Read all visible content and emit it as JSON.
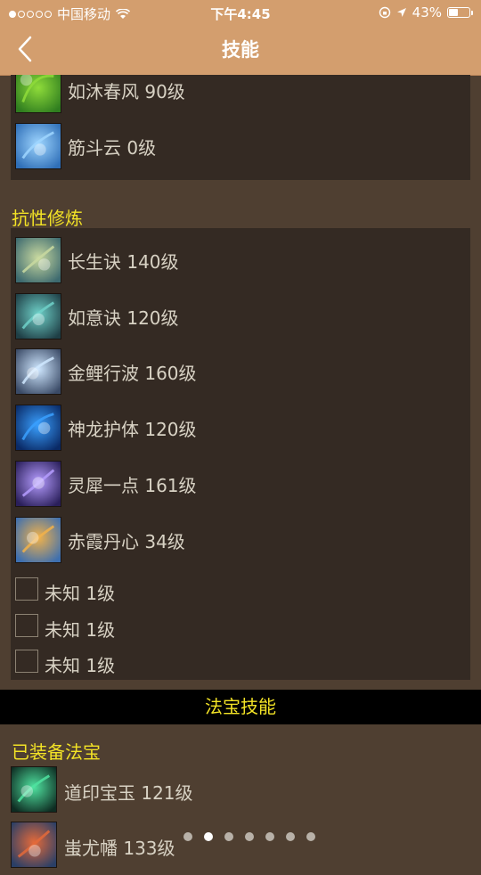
{
  "status_bar": {
    "carrier": "中国移动",
    "time": "下午4:45",
    "battery": "43%",
    "signal_bars_filled": 1
  },
  "nav": {
    "title": "技能"
  },
  "panel_top": {
    "items": [
      {
        "label": "如沐春风 90级",
        "icon": "spring-breeze-skill-icon",
        "colors": [
          "#8fdc3a",
          "#2f7d1f"
        ]
      },
      {
        "label": "筋斗云 0级",
        "icon": "somersault-cloud-skill-icon",
        "colors": [
          "#9fd6ff",
          "#2f6fb8"
        ]
      }
    ]
  },
  "resistance": {
    "title": "抗性修炼",
    "items": [
      {
        "label": "长生诀 140级",
        "icon": "longevity-skill-icon",
        "colors": [
          "#c9d9a0",
          "#3d6a6f"
        ]
      },
      {
        "label": "如意诀 120级",
        "icon": "ruyi-skill-icon",
        "colors": [
          "#6fd1c9",
          "#1f3f46"
        ]
      },
      {
        "label": "金鲤行波 160级",
        "icon": "golden-carp-skill-icon",
        "colors": [
          "#cfe7ff",
          "#3a4a66"
        ]
      },
      {
        "label": "神龙护体 120级",
        "icon": "dragon-guard-skill-icon",
        "colors": [
          "#3aa0ff",
          "#0a2a66"
        ]
      },
      {
        "label": "灵犀一点 161级",
        "icon": "lingxi-skill-icon",
        "colors": [
          "#b59cff",
          "#2a1f5a"
        ]
      },
      {
        "label": "赤霞丹心 34级",
        "icon": "crimson-cloud-skill-icon",
        "colors": [
          "#f2b24a",
          "#3d6fb0"
        ]
      }
    ],
    "unknown_items": [
      {
        "label": "未知 1级"
      },
      {
        "label": "未知 1级"
      },
      {
        "label": "未知 1级"
      }
    ]
  },
  "treasure_band": {
    "title": "法宝技能"
  },
  "equipped": {
    "title": "已装备法宝",
    "items": [
      {
        "label": "道印宝玉 121级",
        "icon": "jade-seal-treasure-icon",
        "colors": [
          "#4fe3a0",
          "#0e2c22"
        ]
      },
      {
        "label": "蚩尤幡 133级",
        "icon": "chiyou-banner-treasure-icon",
        "colors": [
          "#e46a3a",
          "#2a3f66"
        ]
      }
    ]
  },
  "pager": {
    "count": 7,
    "active_index": 1
  }
}
